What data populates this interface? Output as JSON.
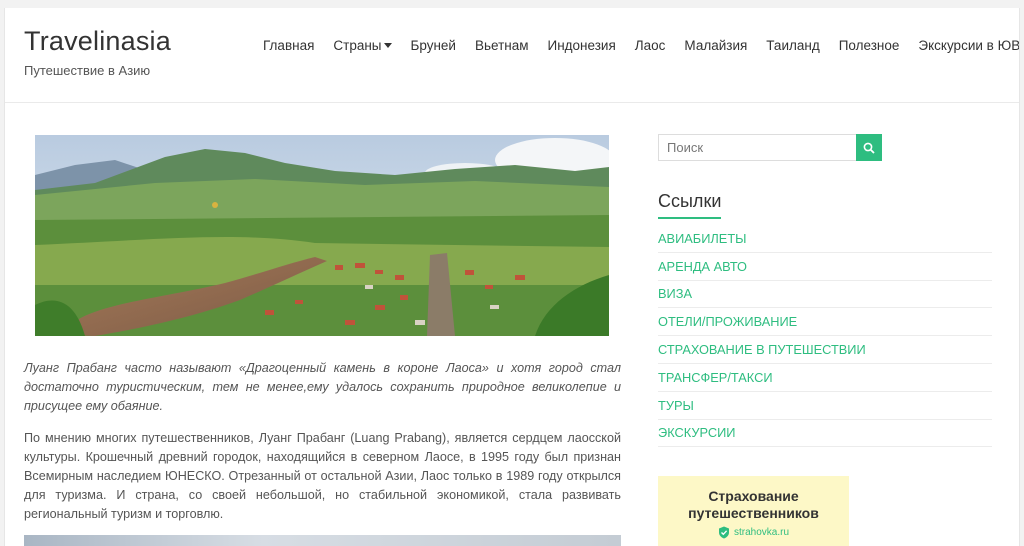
{
  "header": {
    "site_title": "Travelinasia",
    "tagline": "Путешествие в Азию"
  },
  "nav": {
    "items": [
      {
        "label": "Главная",
        "has_dropdown": false
      },
      {
        "label": "Страны",
        "has_dropdown": true
      },
      {
        "label": "Бруней",
        "has_dropdown": false
      },
      {
        "label": "Вьетнам",
        "has_dropdown": false
      },
      {
        "label": "Индонезия",
        "has_dropdown": false
      },
      {
        "label": "Лаос",
        "has_dropdown": false
      },
      {
        "label": "Малайзия",
        "has_dropdown": false
      },
      {
        "label": "Таиланд",
        "has_dropdown": false
      },
      {
        "label": "Полезное",
        "has_dropdown": false
      },
      {
        "label": "Экскурсии в ЮВА",
        "has_dropdown": true
      }
    ]
  },
  "article": {
    "intro": "Луанг Прабанг часто называют «Драгоценный камень в короне Лаоса» и хотя город стал достаточно туристическим, тем не менее,ему удалось сохранить природное великолепие и присущее ему обаяние.",
    "body": "По мнению многих путешественников, Луанг Прабанг (Luang Prabang), является сердцем лаосской культуры. Крошечный древний городок, находящийся в северном Лаосе, в 1995 году был признан Всемирным наследием ЮНЕСКО. Отрезанный от остальной Азии, Лаос только в 1989 году открылся для туризма. И страна, со своей небольшой, но стабильной экономикой, стала развивать региональный туризм и торговлю."
  },
  "sidebar": {
    "search_placeholder": "Поиск",
    "links_title": "Ссылки",
    "links": [
      "АВИАБИЛЕТЫ",
      "АРЕНДА АВТО",
      "ВИЗА",
      "ОТЕЛИ/ПРОЖИВАНИЕ",
      "СТРАХОВАНИЕ В ПУТЕШЕСТВИИ",
      "ТРАНСФЕР/ТАКСИ",
      "ТУРЫ",
      "ЭКСКУРСИИ"
    ],
    "banner": {
      "line1": "Страхование",
      "line2": "путешественников",
      "brand": "strahovka.ru"
    }
  },
  "colors": {
    "accent": "#2ebd80",
    "text": "#444444",
    "banner_bg": "#fdf8c7"
  }
}
